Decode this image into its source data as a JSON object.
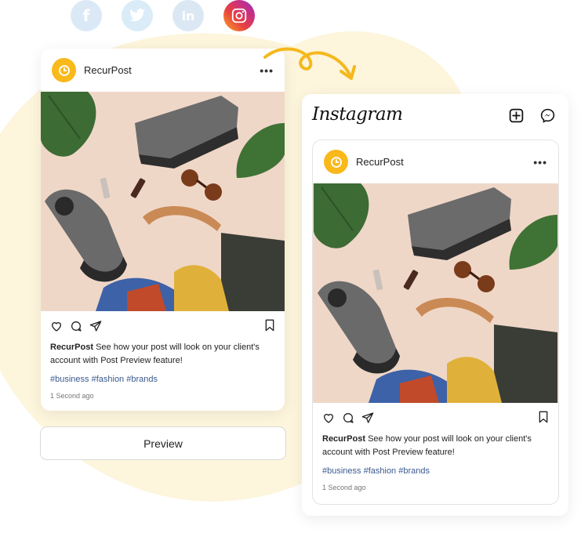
{
  "social": {
    "facebook": {
      "icon": "facebook-icon",
      "glyph": "f"
    },
    "twitter": {
      "icon": "twitter-icon"
    },
    "linkedin": {
      "icon": "linkedin-icon",
      "glyph": "in"
    },
    "instagram": {
      "icon": "instagram-icon"
    }
  },
  "left_post": {
    "username": "RecurPost",
    "caption_user": "RecurPost",
    "caption_text": " See how your post will look on your client's account with Post Preview feature!",
    "hashtags": "#business #fashion #brands",
    "time": "1 Second ago"
  },
  "preview_button": {
    "label": "Preview"
  },
  "instagram_preview": {
    "logo": "Instagram",
    "username": "RecurPost",
    "caption_user": "RecurPost",
    "caption_text": " See how your post will look on your client's account with Post Preview feature!",
    "hashtags": "#business #fashion #brands",
    "time": "1 Second ago"
  },
  "colors": {
    "accent": "#f9b91b",
    "hashtag": "#3b5a8f",
    "background_blob": "#fdf5dc"
  }
}
